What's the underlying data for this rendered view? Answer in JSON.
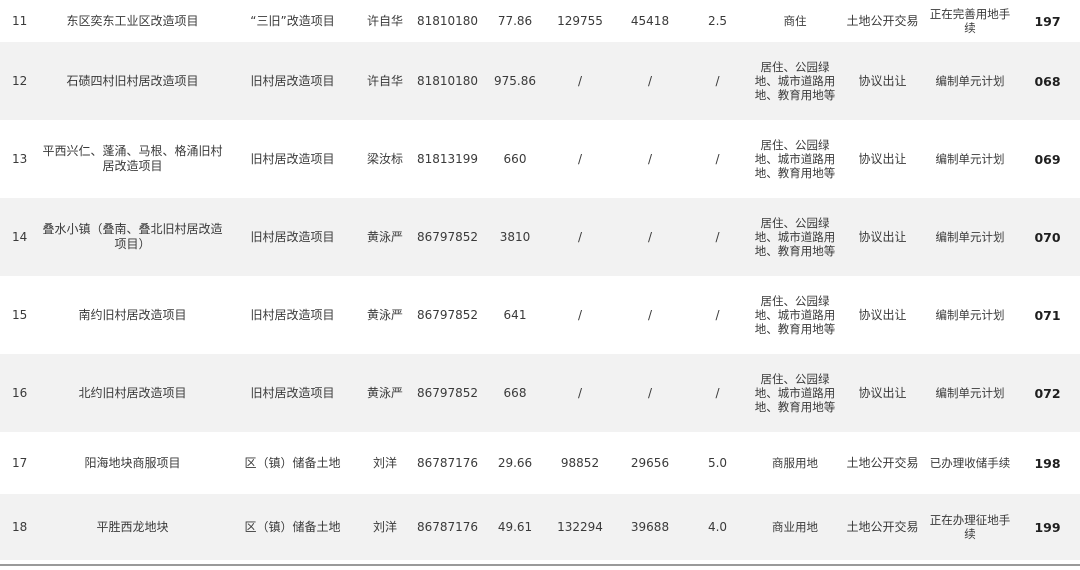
{
  "rows": [
    {
      "no": "11",
      "name": "东区奕东工业区改造项目",
      "type": "“三旧”改造项目",
      "contact": "许自华",
      "phone": "81810180",
      "area": "77.86",
      "v1": "129755",
      "v2": "45418",
      "v3": "2.5",
      "use": "商住",
      "method": "土地公开交易",
      "status": "正在完善用地手续",
      "code": "197"
    },
    {
      "no": "12",
      "name": "石碛四村旧村居改造项目",
      "type": "旧村居改造项目",
      "contact": "许自华",
      "phone": "81810180",
      "area": "975.86",
      "v1": "/",
      "v2": "/",
      "v3": "/",
      "use": "居住、公园绿地、城市道路用地、教育用地等",
      "method": "协议出让",
      "status": "编制单元计划",
      "code": "068"
    },
    {
      "no": "13",
      "name": "平西兴仁、蓬涌、马根、格涌旧村居改造项目",
      "type": "旧村居改造项目",
      "contact": "梁汝标",
      "phone": "81813199",
      "area": "660",
      "v1": "/",
      "v2": "/",
      "v3": "/",
      "use": "居住、公园绿地、城市道路用地、教育用地等",
      "method": "协议出让",
      "status": "编制单元计划",
      "code": "069"
    },
    {
      "no": "14",
      "name": "叠水小镇（叠南、叠北旧村居改造项目）",
      "type": "旧村居改造项目",
      "contact": "黄泳严",
      "phone": "86797852",
      "area": "3810",
      "v1": "/",
      "v2": "/",
      "v3": "/",
      "use": "居住、公园绿地、城市道路用地、教育用地等",
      "method": "协议出让",
      "status": "编制单元计划",
      "code": "070"
    },
    {
      "no": "15",
      "name": "南约旧村居改造项目",
      "type": "旧村居改造项目",
      "contact": "黄泳严",
      "phone": "86797852",
      "area": "641",
      "v1": "/",
      "v2": "/",
      "v3": "/",
      "use": "居住、公园绿地、城市道路用地、教育用地等",
      "method": "协议出让",
      "status": "编制单元计划",
      "code": "071"
    },
    {
      "no": "16",
      "name": "北约旧村居改造项目",
      "type": "旧村居改造项目",
      "contact": "黄泳严",
      "phone": "86797852",
      "area": "668",
      "v1": "/",
      "v2": "/",
      "v3": "/",
      "use": "居住、公园绿地、城市道路用地、教育用地等",
      "method": "协议出让",
      "status": "编制单元计划",
      "code": "072"
    },
    {
      "no": "17",
      "name": "阳海地块商服项目",
      "type": "区（镇）储备土地",
      "contact": "刘洋",
      "phone": "86787176",
      "area": "29.66",
      "v1": "98852",
      "v2": "29656",
      "v3": "5.0",
      "use": "商服用地",
      "method": "土地公开交易",
      "status": "已办理收储手续",
      "code": "198"
    },
    {
      "no": "18",
      "name": "平胜西龙地块",
      "type": "区（镇）储备土地",
      "contact": "刘洋",
      "phone": "86787176",
      "area": "49.61",
      "v1": "132294",
      "v2": "39688",
      "v3": "4.0",
      "use": "商业用地",
      "method": "土地公开交易",
      "status": "正在办理征地手续",
      "code": "199"
    }
  ]
}
